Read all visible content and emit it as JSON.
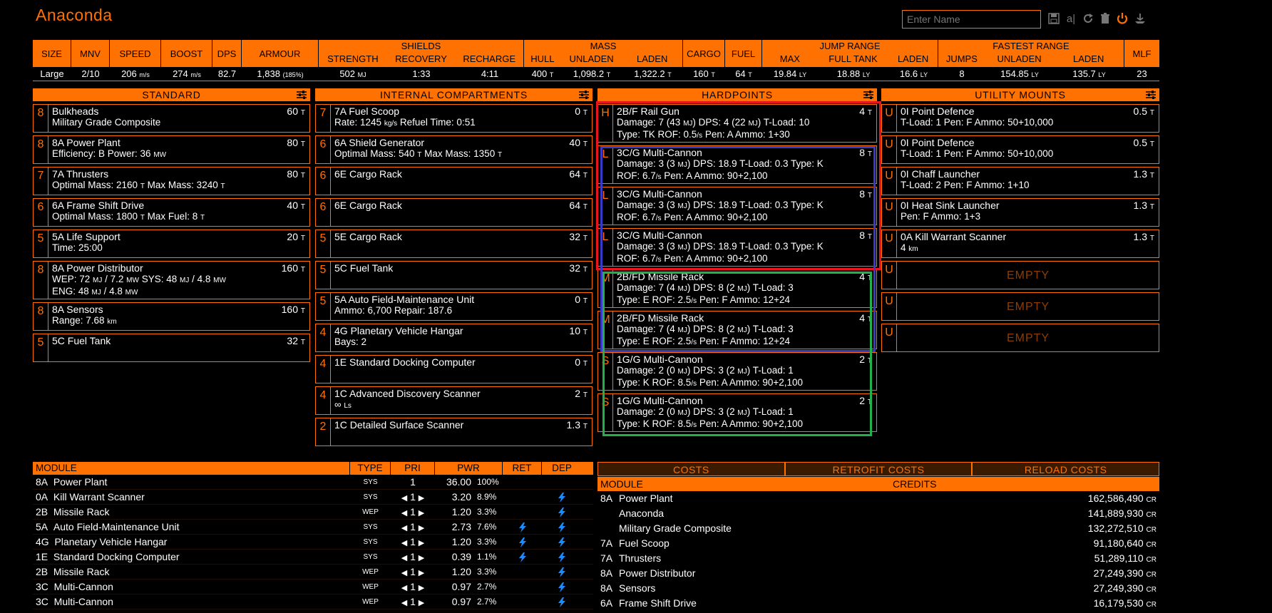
{
  "app": {
    "title": "Anaconda",
    "name_placeholder": "Enter Name"
  },
  "toolbar": {
    "icons": [
      "save-icon",
      "rename-icon",
      "reload-icon",
      "delete-icon",
      "power-icon",
      "ship-icon"
    ],
    "rename_glyph": "a|"
  },
  "stats": {
    "headers": {
      "size": "SIZE",
      "mnv": "MNV",
      "speed": "SPEED",
      "boost": "BOOST",
      "dps": "DPS",
      "armour": "ARMOUR",
      "shields": "SHIELDS",
      "strength": "STRENGTH",
      "recovery": "RECOVERY",
      "recharge": "RECHARGE",
      "mass": "MASS",
      "hull": "HULL",
      "unladen": "UNLADEN",
      "laden": "LADEN",
      "cargo": "CARGO",
      "fuel": "FUEL",
      "jump_range": "JUMP RANGE",
      "max": "MAX",
      "full_tank": "FULL TANK",
      "jr_laden": "LADEN",
      "fastest_range": "FASTEST RANGE",
      "jumps": "JUMPS",
      "fr_unladen": "UNLADEN",
      "fr_laden": "LADEN",
      "mlf": "MLF"
    },
    "values": {
      "size": "Large",
      "mnv": "2/10",
      "speed": "206",
      "speed_u": "m/s",
      "boost": "274",
      "boost_u": "m/s",
      "dps": "82.7",
      "armour": "1,838",
      "armour_pct": "(185%)",
      "strength": "502",
      "strength_u": "MJ",
      "recovery": "1:33",
      "recharge": "4:11",
      "hull": "400",
      "hull_u": "T",
      "unladen": "1,098.2",
      "unladen_u": "T",
      "laden": "1,322.2",
      "laden_u": "T",
      "cargo": "160",
      "cargo_u": "T",
      "fuel": "64",
      "fuel_u": "T",
      "max": "19.84",
      "max_u": "LY",
      "full_tank": "18.88",
      "full_tank_u": "LY",
      "jr_laden": "16.6",
      "jr_laden_u": "LY",
      "jumps": "8",
      "fr_unladen": "154.85",
      "fr_unladen_u": "LY",
      "fr_laden": "135.7",
      "fr_laden_u": "LY",
      "mlf": "23"
    }
  },
  "standard": {
    "title": "STANDARD",
    "slots": [
      {
        "cls": "8",
        "name": "Bulkheads",
        "detail": "Military Grade Composite",
        "mass": "60 T"
      },
      {
        "cls": "8",
        "name": "8A Power Plant",
        "detail": "Efficiency: B   Power: 36 MW",
        "mass": "80 T"
      },
      {
        "cls": "7",
        "name": "7A Thrusters",
        "detail": "Optimal Mass: 2160 T   Max Mass: 3240 T",
        "mass": "80 T"
      },
      {
        "cls": "6",
        "name": "6A Frame Shift Drive",
        "detail": "Optimal Mass: 1800 T   Max Fuel: 8 T",
        "mass": "40 T"
      },
      {
        "cls": "5",
        "name": "5A Life Support",
        "detail": "Time: 25:00",
        "mass": "20 T"
      },
      {
        "cls": "8",
        "name": "8A Power Distributor",
        "detail": "WEP: 72 MJ / 7.2 MW   SYS: 48 MJ / 4.8 MW",
        "detail2": "ENG: 48 MJ / 4.8 MW",
        "mass": "160 T"
      },
      {
        "cls": "8",
        "name": "8A Sensors",
        "detail": "Range: 7.68 km",
        "mass": "160 T"
      },
      {
        "cls": "5",
        "name": "5C Fuel Tank",
        "detail": "",
        "mass": "32 T"
      }
    ]
  },
  "internal": {
    "title": "INTERNAL COMPARTMENTS",
    "slots": [
      {
        "cls": "7",
        "name": "7A Fuel Scoop",
        "detail": "Rate: 1245 kg/s   Refuel Time: 0:51",
        "mass": "0 T"
      },
      {
        "cls": "6",
        "name": "6A Shield Generator",
        "detail": "Optimal Mass: 540 T   Max Mass: 1350 T",
        "mass": "40 T"
      },
      {
        "cls": "6",
        "name": "6E Cargo Rack",
        "detail": "",
        "mass": "64 T"
      },
      {
        "cls": "6",
        "name": "6E Cargo Rack",
        "detail": "",
        "mass": "64 T"
      },
      {
        "cls": "5",
        "name": "5E Cargo Rack",
        "detail": "",
        "mass": "32 T"
      },
      {
        "cls": "5",
        "name": "5C Fuel Tank",
        "detail": "",
        "mass": "32 T"
      },
      {
        "cls": "5",
        "name": "5A Auto Field-Maintenance Unit",
        "detail": "Ammo: 6,700   Repair: 187.6",
        "mass": "0 T"
      },
      {
        "cls": "4",
        "name": "4G Planetary Vehicle Hangar",
        "detail": "Bays: 2",
        "mass": "10 T"
      },
      {
        "cls": "4",
        "name": "1E Standard Docking Computer",
        "detail": "",
        "mass": "0 T"
      },
      {
        "cls": "4",
        "name": "1C Advanced Discovery Scanner",
        "detail": "∞ Ls",
        "mass": "2 T"
      },
      {
        "cls": "2",
        "name": "1C Detailed Surface Scanner",
        "detail": "",
        "mass": "1.3 T"
      }
    ]
  },
  "hardpoints": {
    "title": "HARDPOINTS",
    "slots": [
      {
        "cls": "H",
        "name": "2B/F Rail Gun",
        "d1": "Damage: 7 (43 MJ)   DPS: 4 (22 MJ)   T-Load: 10",
        "d2": "Type: TK   ROF: 0.5/s   Pen: A   Ammo: 1+30",
        "mass": "4 T"
      },
      {
        "cls": "L",
        "name": "3C/G Multi-Cannon",
        "d1": "Damage: 3 (3 MJ)   DPS: 18.9   T-Load: 0.3   Type: K",
        "d2": "ROF: 6.7/s   Pen: A   Ammo: 90+2,100",
        "mass": "8 T"
      },
      {
        "cls": "L",
        "name": "3C/G Multi-Cannon",
        "d1": "Damage: 3 (3 MJ)   DPS: 18.9   T-Load: 0.3   Type: K",
        "d2": "ROF: 6.7/s   Pen: A   Ammo: 90+2,100",
        "mass": "8 T"
      },
      {
        "cls": "L",
        "name": "3C/G Multi-Cannon",
        "d1": "Damage: 3 (3 MJ)   DPS: 18.9   T-Load: 0.3   Type: K",
        "d2": "ROF: 6.7/s   Pen: A   Ammo: 90+2,100",
        "mass": "8 T"
      },
      {
        "cls": "M",
        "name": "2B/FD Missile Rack",
        "d1": "Damage: 7 (4 MJ)   DPS: 8 (2 MJ)   T-Load: 3",
        "d2": "Type: E   ROF: 2.5/s   Pen: F   Ammo: 12+24",
        "mass": "4 T"
      },
      {
        "cls": "M",
        "name": "2B/FD Missile Rack",
        "d1": "Damage: 7 (4 MJ)   DPS: 8 (2 MJ)   T-Load: 3",
        "d2": "Type: E   ROF: 2.5/s   Pen: F   Ammo: 12+24",
        "mass": "4 T"
      },
      {
        "cls": "S",
        "name": "1G/G Multi-Cannon",
        "d1": "Damage: 2 (0 MJ)   DPS: 3 (2 MJ)   T-Load: 1",
        "d2": "Type: K   ROF: 8.5/s   Pen: A   Ammo: 90+2,100",
        "mass": "2 T"
      },
      {
        "cls": "S",
        "name": "1G/G Multi-Cannon",
        "d1": "Damage: 2 (0 MJ)   DPS: 3 (2 MJ)   T-Load: 1",
        "d2": "Type: K   ROF: 8.5/s   Pen: A   Ammo: 90+2,100",
        "mass": "2 T"
      }
    ]
  },
  "utility": {
    "title": "UTILITY MOUNTS",
    "empty_label": "EMPTY",
    "slots": [
      {
        "cls": "U",
        "name": "0I Point Defence",
        "detail": "T-Load: 1   Pen: F   Ammo: 50+10,000",
        "mass": "0.5 T"
      },
      {
        "cls": "U",
        "name": "0I Point Defence",
        "detail": "T-Load: 1   Pen: F   Ammo: 50+10,000",
        "mass": "0.5 T"
      },
      {
        "cls": "U",
        "name": "0I Chaff Launcher",
        "detail": "T-Load: 2   Pen: F   Ammo: 1+10",
        "mass": "1.3 T"
      },
      {
        "cls": "U",
        "name": "0I Heat Sink Launcher",
        "detail": "Pen: F   Ammo: 1+3",
        "mass": "1.3 T"
      },
      {
        "cls": "U",
        "name": "0A Kill Warrant Scanner",
        "detail": "4 km",
        "mass": "1.3 T"
      },
      {
        "cls": "U",
        "empty": true
      },
      {
        "cls": "U",
        "empty": true
      },
      {
        "cls": "U",
        "empty": true
      }
    ]
  },
  "modules": {
    "headers": {
      "module": "MODULE",
      "type": "TYPE",
      "pri": "PRI",
      "pwr": "PWR",
      "ret": "RET",
      "dep": "DEP"
    },
    "rows": [
      {
        "code": "8A",
        "name": "Power Plant",
        "type": "SYS",
        "pri": "1",
        "pwr": "36.00",
        "pct": "100%",
        "ret": false,
        "dep": false,
        "arrows": false
      },
      {
        "code": "0A",
        "name": "Kill Warrant Scanner",
        "type": "SYS",
        "pri": "1",
        "pwr": "3.20",
        "pct": "8.9%",
        "ret": false,
        "dep": true,
        "arrows": true
      },
      {
        "code": "2B",
        "name": "Missile Rack",
        "type": "WEP",
        "pri": "1",
        "pwr": "1.20",
        "pct": "3.3%",
        "ret": false,
        "dep": true,
        "arrows": true
      },
      {
        "code": "5A",
        "name": "Auto Field-Maintenance Unit",
        "type": "SYS",
        "pri": "1",
        "pwr": "2.73",
        "pct": "7.6%",
        "ret": true,
        "dep": true,
        "arrows": true
      },
      {
        "code": "4G",
        "name": "Planetary Vehicle Hangar",
        "type": "SYS",
        "pri": "1",
        "pwr": "1.20",
        "pct": "3.3%",
        "ret": true,
        "dep": true,
        "arrows": true
      },
      {
        "code": "1E",
        "name": "Standard Docking Computer",
        "type": "SYS",
        "pri": "1",
        "pwr": "0.39",
        "pct": "1.1%",
        "ret": true,
        "dep": true,
        "arrows": true
      },
      {
        "code": "2B",
        "name": "Missile Rack",
        "type": "WEP",
        "pri": "1",
        "pwr": "1.20",
        "pct": "3.3%",
        "ret": false,
        "dep": true,
        "arrows": true
      },
      {
        "code": "3C",
        "name": "Multi-Cannon",
        "type": "WEP",
        "pri": "1",
        "pwr": "0.97",
        "pct": "2.7%",
        "ret": false,
        "dep": true,
        "arrows": true
      },
      {
        "code": "3C",
        "name": "Multi-Cannon",
        "type": "WEP",
        "pri": "1",
        "pwr": "0.97",
        "pct": "2.7%",
        "ret": false,
        "dep": true,
        "arrows": true
      }
    ]
  },
  "costs": {
    "tabs": [
      "COSTS",
      "RETROFIT COSTS",
      "RELOAD COSTS"
    ],
    "headers": {
      "module": "MODULE",
      "credits": "CREDITS"
    },
    "unit": "CR",
    "rows": [
      {
        "code": "8A",
        "name": "Power Plant",
        "value": "162,586,490"
      },
      {
        "code": "",
        "name": "Anaconda",
        "value": "141,889,930"
      },
      {
        "code": "",
        "name": "Military Grade Composite",
        "value": "132,272,510"
      },
      {
        "code": "7A",
        "name": "Fuel Scoop",
        "value": "91,180,640"
      },
      {
        "code": "7A",
        "name": "Thrusters",
        "value": "51,289,110"
      },
      {
        "code": "8A",
        "name": "Power Distributor",
        "value": "27,249,390"
      },
      {
        "code": "8A",
        "name": "Sensors",
        "value": "27,249,390"
      },
      {
        "code": "6A",
        "name": "Frame Shift Drive",
        "value": "16,179,530"
      }
    ]
  },
  "highlight_colors": {
    "red": "#e8141e",
    "blue": "#3a39c8",
    "green": "#22b04a"
  },
  "accent": "#ff7100"
}
